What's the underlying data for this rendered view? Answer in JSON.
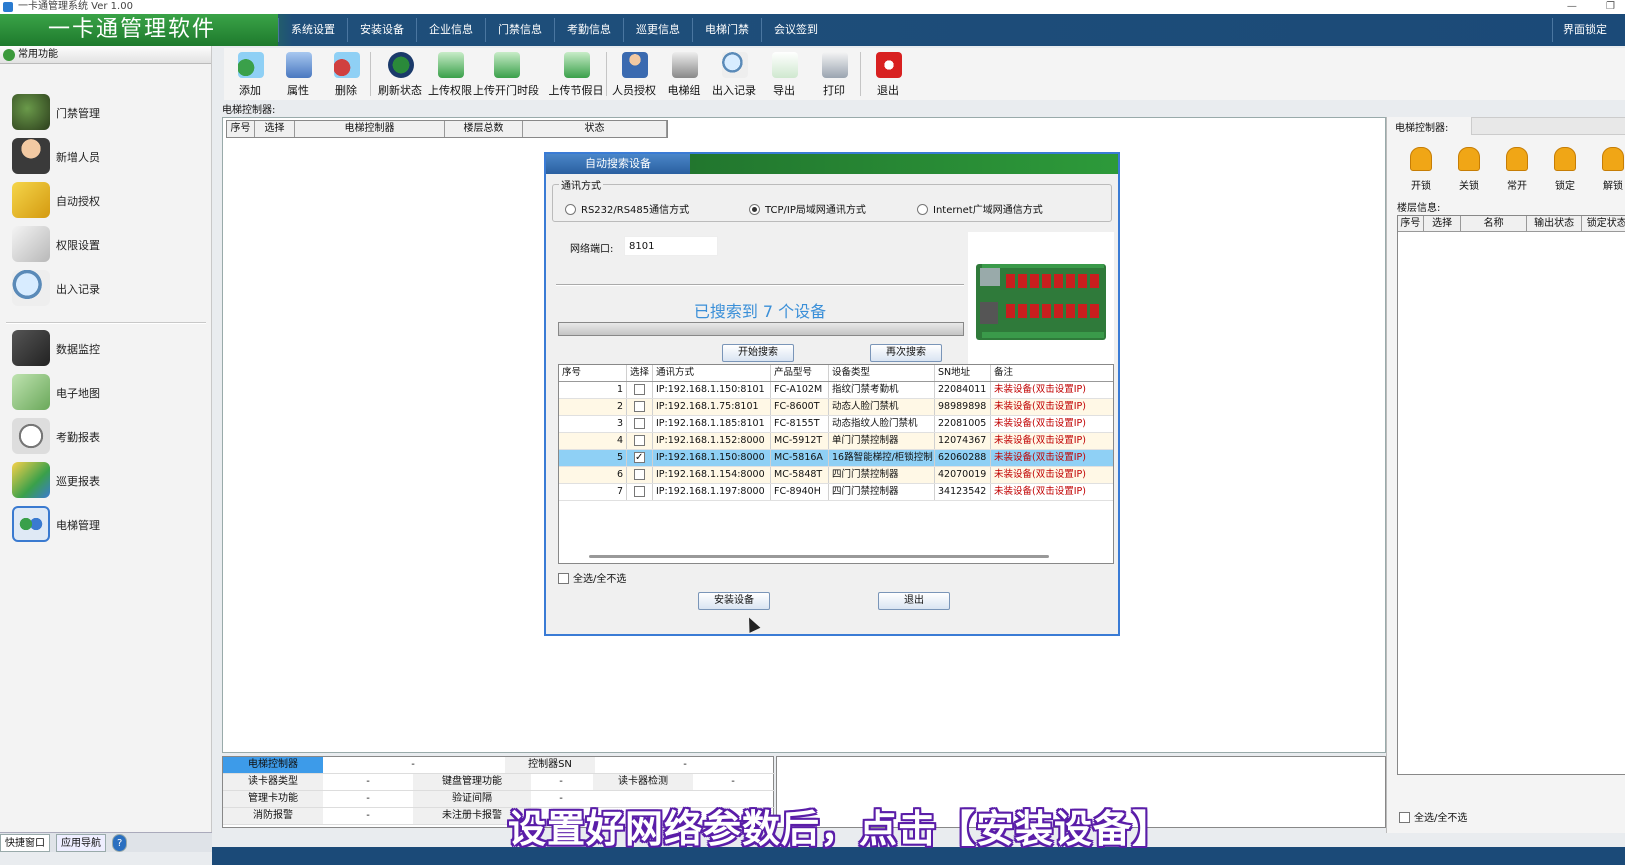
{
  "window": {
    "title": "一卡通管理系统  Ver 1.00"
  },
  "app": {
    "brand": "一卡通管理软件"
  },
  "menu": {
    "items": [
      "系统设置",
      "安装设备",
      "企业信息",
      "门禁信息",
      "考勤信息",
      "巡更信息",
      "电梯门禁",
      "会议签到"
    ],
    "lock_label": "界面锁定"
  },
  "sidebar": {
    "section": "常用功能",
    "items": [
      "门禁管理",
      "新增人员",
      "自动授权",
      "权限设置",
      "出入记录",
      "数据监控",
      "电子地图",
      "考勤报表",
      "巡更报表",
      "电梯管理"
    ],
    "tabs": [
      "快捷窗口",
      "应用导航",
      "?"
    ]
  },
  "toolbar": {
    "buttons": [
      "添加",
      "属性",
      "删除",
      "刷新状态",
      "上传权限",
      "上传开门时段",
      "上传节假日",
      "人员授权",
      "电梯组",
      "出入记录",
      "导出",
      "打印",
      "退出"
    ]
  },
  "main": {
    "label": "电梯控制器:",
    "columns": [
      "序号",
      "选择",
      "电梯控制器",
      "楼层总数",
      "状态"
    ]
  },
  "right": {
    "controller_label": "电梯控制器:",
    "lock_buttons": [
      "开锁",
      "关锁",
      "常开",
      "锁定",
      "解锁"
    ],
    "floor_label": "楼层信息:",
    "columns": [
      "序号",
      "选择",
      "名称",
      "输出状态",
      "锁定状态"
    ],
    "select_all": "全选/全不选"
  },
  "info": {
    "rows": [
      [
        "电梯控制器",
        "-",
        "控制器SN",
        "-"
      ],
      [
        "读卡器类型",
        "-",
        "键盘管理功能",
        "-",
        "读卡器检测",
        "-"
      ],
      [
        "管理卡功能",
        "-",
        "验证间隔",
        "-"
      ],
      [
        "消防报警",
        "-",
        "未注册卡报警",
        ""
      ]
    ]
  },
  "dialog": {
    "title": "自动搜索设备",
    "comm_legend": "通讯方式",
    "comm_options": [
      "RS232/RS485通信方式",
      "TCP/IP局域网通讯方式",
      "Internet广域网通信方式"
    ],
    "comm_selected": 1,
    "port_label": "网络端口:",
    "port_value": "8101",
    "found_text": "已搜索到   7 个设备",
    "start_button": "开始搜索",
    "research_button": "再次搜索",
    "columns": [
      "序号",
      "选择",
      "通讯方式",
      "产品型号",
      "设备类型",
      "SN地址",
      "备注"
    ],
    "rows": [
      {
        "no": "1",
        "checked": false,
        "comm": "IP:192.168.1.150:8101",
        "model": "FC-A102M",
        "type": "指纹门禁考勤机",
        "sn": "22084011",
        "note": "未装设备(双击设置IP)"
      },
      {
        "no": "2",
        "checked": false,
        "comm": "IP:192.168.1.75:8101",
        "model": "FC-8600T",
        "type": "动态人脸门禁机",
        "sn": "98989898",
        "note": "未装设备(双击设置IP)"
      },
      {
        "no": "3",
        "checked": false,
        "comm": "IP:192.168.1.185:8101",
        "model": "FC-8155T",
        "type": "动态指纹人脸门禁机",
        "sn": "22081005",
        "note": "未装设备(双击设置IP)"
      },
      {
        "no": "4",
        "checked": false,
        "comm": "IP:192.168.1.152:8000",
        "model": "MC-5912T",
        "type": "单门门禁控制器",
        "sn": "12074367",
        "note": "未装设备(双击设置IP)"
      },
      {
        "no": "5",
        "checked": true,
        "comm": "IP:192.168.1.150:8000",
        "model": "MC-5816A",
        "type": "16路智能梯控/柜锁控制",
        "sn": "62060288",
        "note": "未装设备(双击设置IP)"
      },
      {
        "no": "6",
        "checked": false,
        "comm": "IP:192.168.1.154:8000",
        "model": "MC-5848T",
        "type": "四门门禁控制器",
        "sn": "42070019",
        "note": "未装设备(双击设置IP)"
      },
      {
        "no": "7",
        "checked": false,
        "comm": "IP:192.168.1.197:8000",
        "model": "FC-8940H",
        "type": "四门门禁控制器",
        "sn": "34123542",
        "note": "未装设备(双击设置IP)"
      }
    ],
    "select_all": "全选/全不选",
    "install_button": "安装设备",
    "exit_button": "退出"
  },
  "subtitle": "设置好网络参数后，点击【安装设备】",
  "colors": {
    "brand_green": "#2d8f3a",
    "menu_blue": "#1b4a78",
    "selected_row": "#8fd0f5",
    "note_red": "#c00000",
    "subtitle_stroke": "#5a1da8"
  }
}
